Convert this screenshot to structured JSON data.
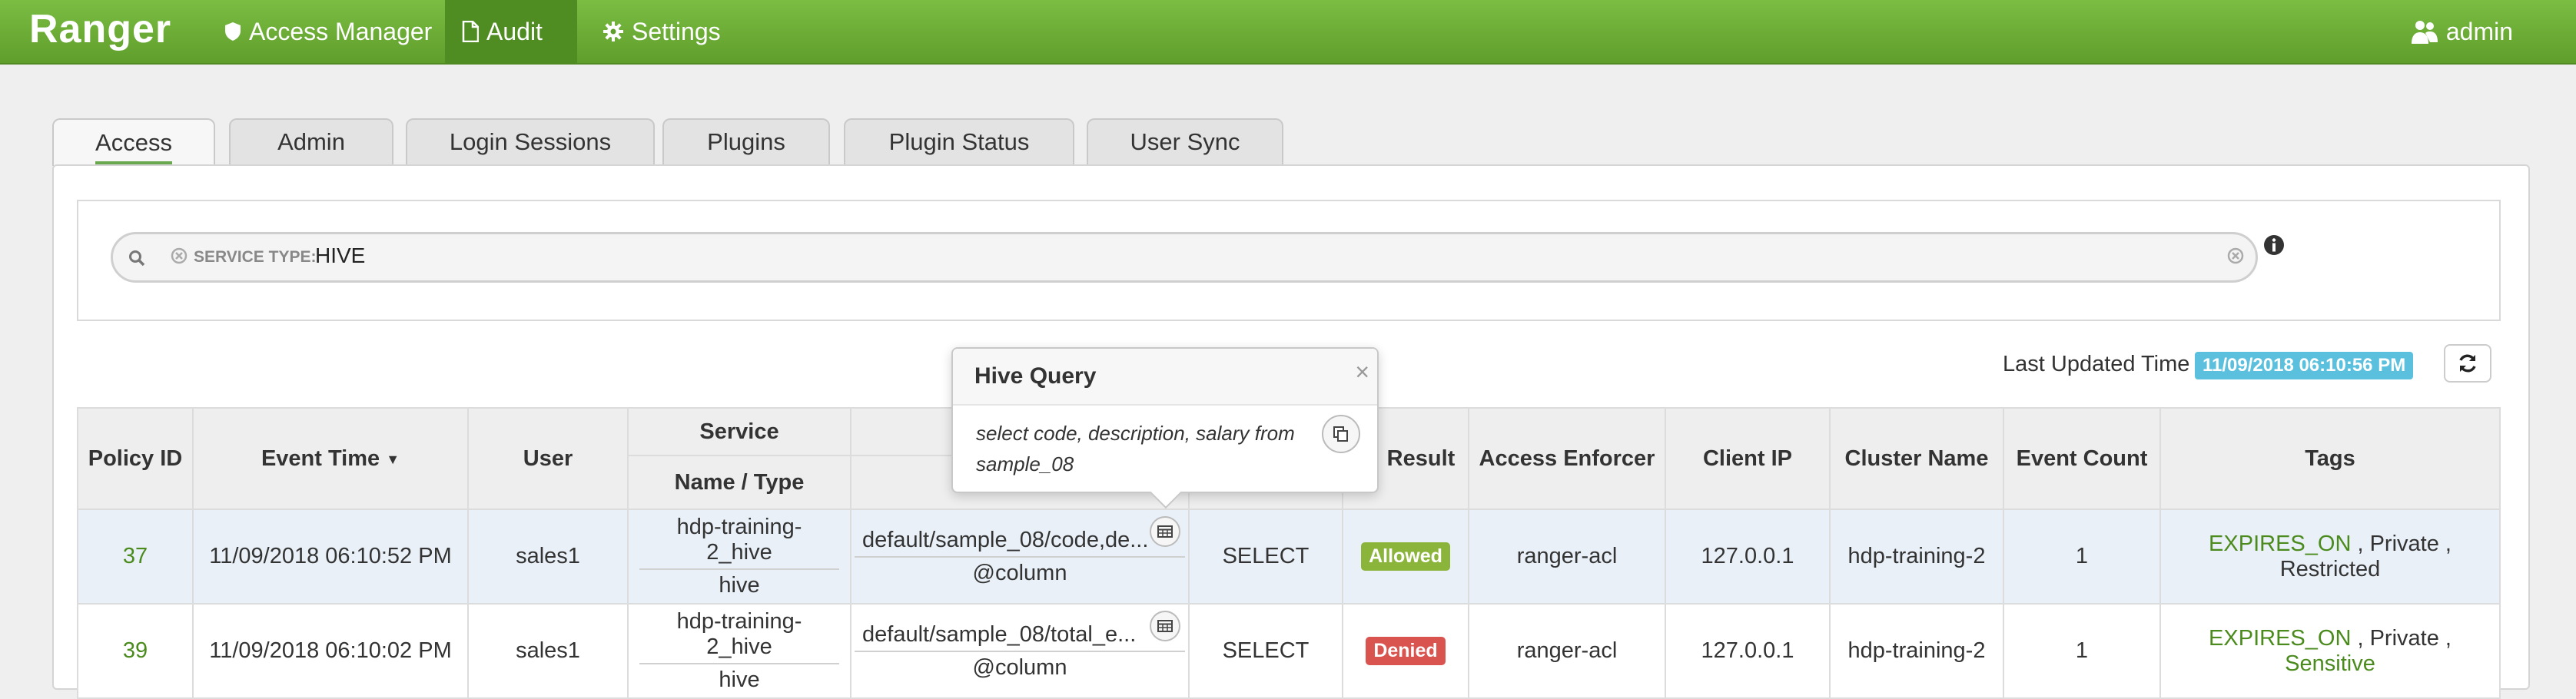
{
  "navbar": {
    "brand": "Ranger",
    "items": [
      {
        "label": "Access Manager",
        "icon": "shield-icon"
      },
      {
        "label": "Audit",
        "icon": "file-icon",
        "active": true
      },
      {
        "label": "Settings",
        "icon": "gear-icon"
      }
    ],
    "user": {
      "label": "admin",
      "icon": "users-icon"
    },
    "colors": {
      "navbar": "#6aad35",
      "active": "#4f8d22"
    }
  },
  "tabs": [
    {
      "label": "Access",
      "active": true
    },
    {
      "label": "Admin"
    },
    {
      "label": "Login Sessions"
    },
    {
      "label": "Plugins"
    },
    {
      "label": "Plugin Status"
    },
    {
      "label": "User Sync"
    }
  ],
  "search": {
    "facet_label": "SERVICE TYPE:",
    "facet_value": "HIVE"
  },
  "status": {
    "last_updated_label": "Last Updated Time :",
    "last_updated_value": "11/09/2018 06:10:56 PM"
  },
  "table": {
    "group_header": "Service",
    "headers": {
      "policy_id": "Policy ID",
      "event_time": "Event Time",
      "user": "User",
      "service_sub": "Name / Type",
      "result": "Result",
      "access_enforcer": "Access Enforcer",
      "client_ip": "Client IP",
      "cluster_name": "Cluster Name",
      "event_count": "Event Count",
      "tags": "Tags"
    },
    "rows": [
      {
        "policy_id": "37",
        "event_time": "11/09/2018 06:10:52 PM",
        "user": "sales1",
        "service_name": "hdp-training-2_hive",
        "service_type": "hive",
        "resource_path": "default/sample_08/code,de...",
        "resource_type": "@column",
        "access_type": "SELECT",
        "result": "Allowed",
        "access_enforcer": "ranger-acl",
        "client_ip": "127.0.0.1",
        "cluster_name": "hdp-training-2",
        "event_count": "1",
        "tags": [
          "EXPIRES_ON",
          "Private",
          "Restricted"
        ]
      },
      {
        "policy_id": "39",
        "event_time": "11/09/2018 06:10:02 PM",
        "user": "sales1",
        "service_name": "hdp-training-2_hive",
        "service_type": "hive",
        "resource_path": "default/sample_08/total_e...",
        "resource_type": "@column",
        "access_type": "SELECT",
        "result": "Denied",
        "access_enforcer": "ranger-acl",
        "client_ip": "127.0.0.1",
        "cluster_name": "hdp-training-2",
        "event_count": "1",
        "tags": [
          "EXPIRES_ON",
          "Private",
          "Sensitive"
        ]
      }
    ]
  },
  "popover": {
    "title": "Hive Query",
    "close": "×",
    "body": "select code, description, salary from sample_08"
  }
}
